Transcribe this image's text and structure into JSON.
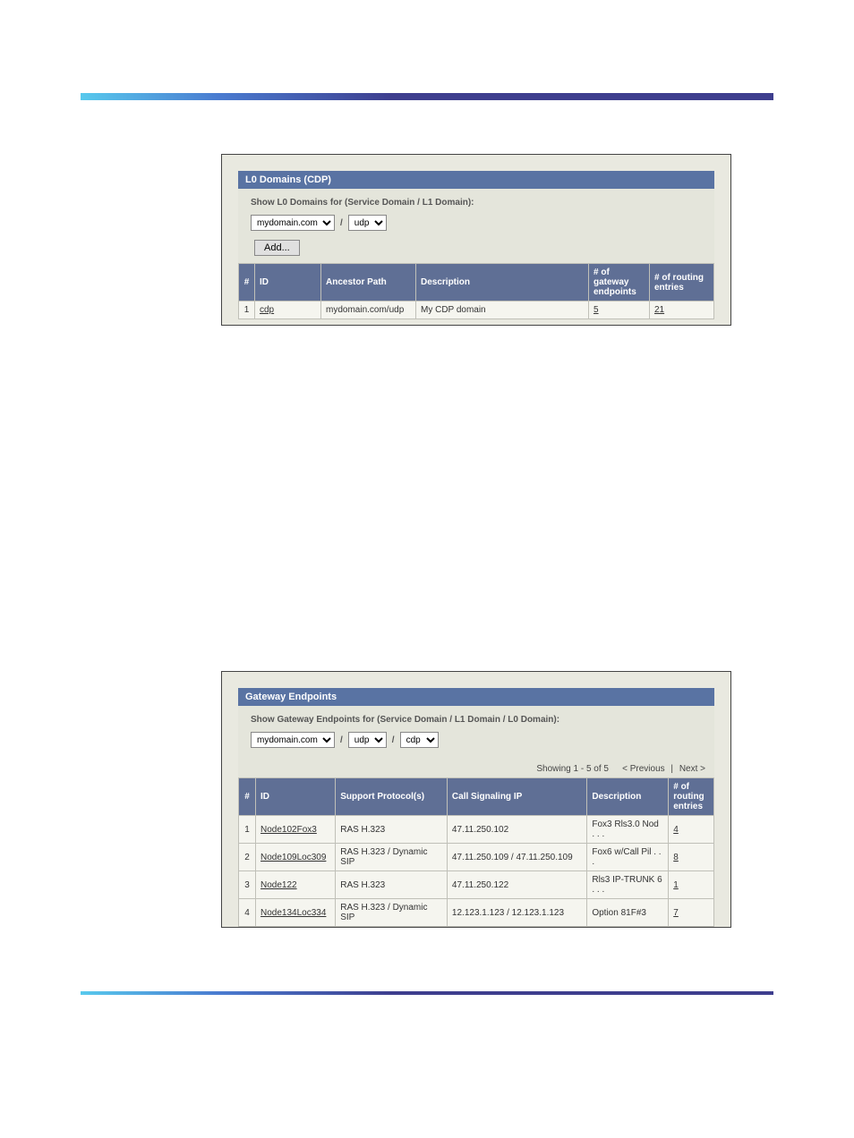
{
  "header_bar": {},
  "figure1": {
    "panel_title": "L0 Domains (CDP)",
    "filter_label": "Show L0 Domains for (Service Domain / L1 Domain):",
    "service_domain_select": "mydomain.com",
    "l1_domain_select": "udp",
    "add_button": "Add...",
    "columns": {
      "num": "#",
      "id": "ID",
      "ancestor": "Ancestor Path",
      "desc": "Description",
      "gw": "# of gateway endpoints",
      "routing": "# of routing entries"
    },
    "rows": [
      {
        "num": "1",
        "id": "cdp",
        "ancestor": "mydomain.com/udp",
        "desc": "My CDP domain",
        "gw": "5",
        "routing": "21"
      }
    ]
  },
  "figure2": {
    "panel_title": "Gateway Endpoints",
    "filter_label": "Show Gateway Endpoints for (Service Domain / L1 Domain / L0 Domain):",
    "service_domain_select": "mydomain.com",
    "l1_domain_select": "udp",
    "l0_domain_select": "cdp",
    "paging_showing": "Showing 1 - 5 of 5",
    "paging_prev": "< Previous",
    "paging_next": "Next >",
    "columns": {
      "num": "#",
      "id": "ID",
      "proto": "Support Protocol(s)",
      "sigip": "Call Signaling IP",
      "desc": "Description",
      "routing": "# of routing entries"
    },
    "rows": [
      {
        "num": "1",
        "id": "Node102Fox3",
        "proto": "RAS H.323",
        "sigip": "47.11.250.102",
        "desc": "Fox3 Rls3.0 Nod . . .",
        "routing": "4"
      },
      {
        "num": "2",
        "id": "Node109Loc309",
        "proto": "RAS H.323 / Dynamic SIP",
        "sigip": "47.11.250.109 / 47.11.250.109",
        "desc": "Fox6 w/Call Pil . . .",
        "routing": "8"
      },
      {
        "num": "3",
        "id": "Node122",
        "proto": "RAS H.323",
        "sigip": "47.11.250.122",
        "desc": "Rls3 IP-TRUNK 6 . . .",
        "routing": "1"
      },
      {
        "num": "4",
        "id": "Node134Loc334",
        "proto": "RAS H.323 / Dynamic SIP",
        "sigip": "12.123.1.123 / 12.123.1.123",
        "desc": "Option 81F#3",
        "routing": "7"
      }
    ]
  }
}
